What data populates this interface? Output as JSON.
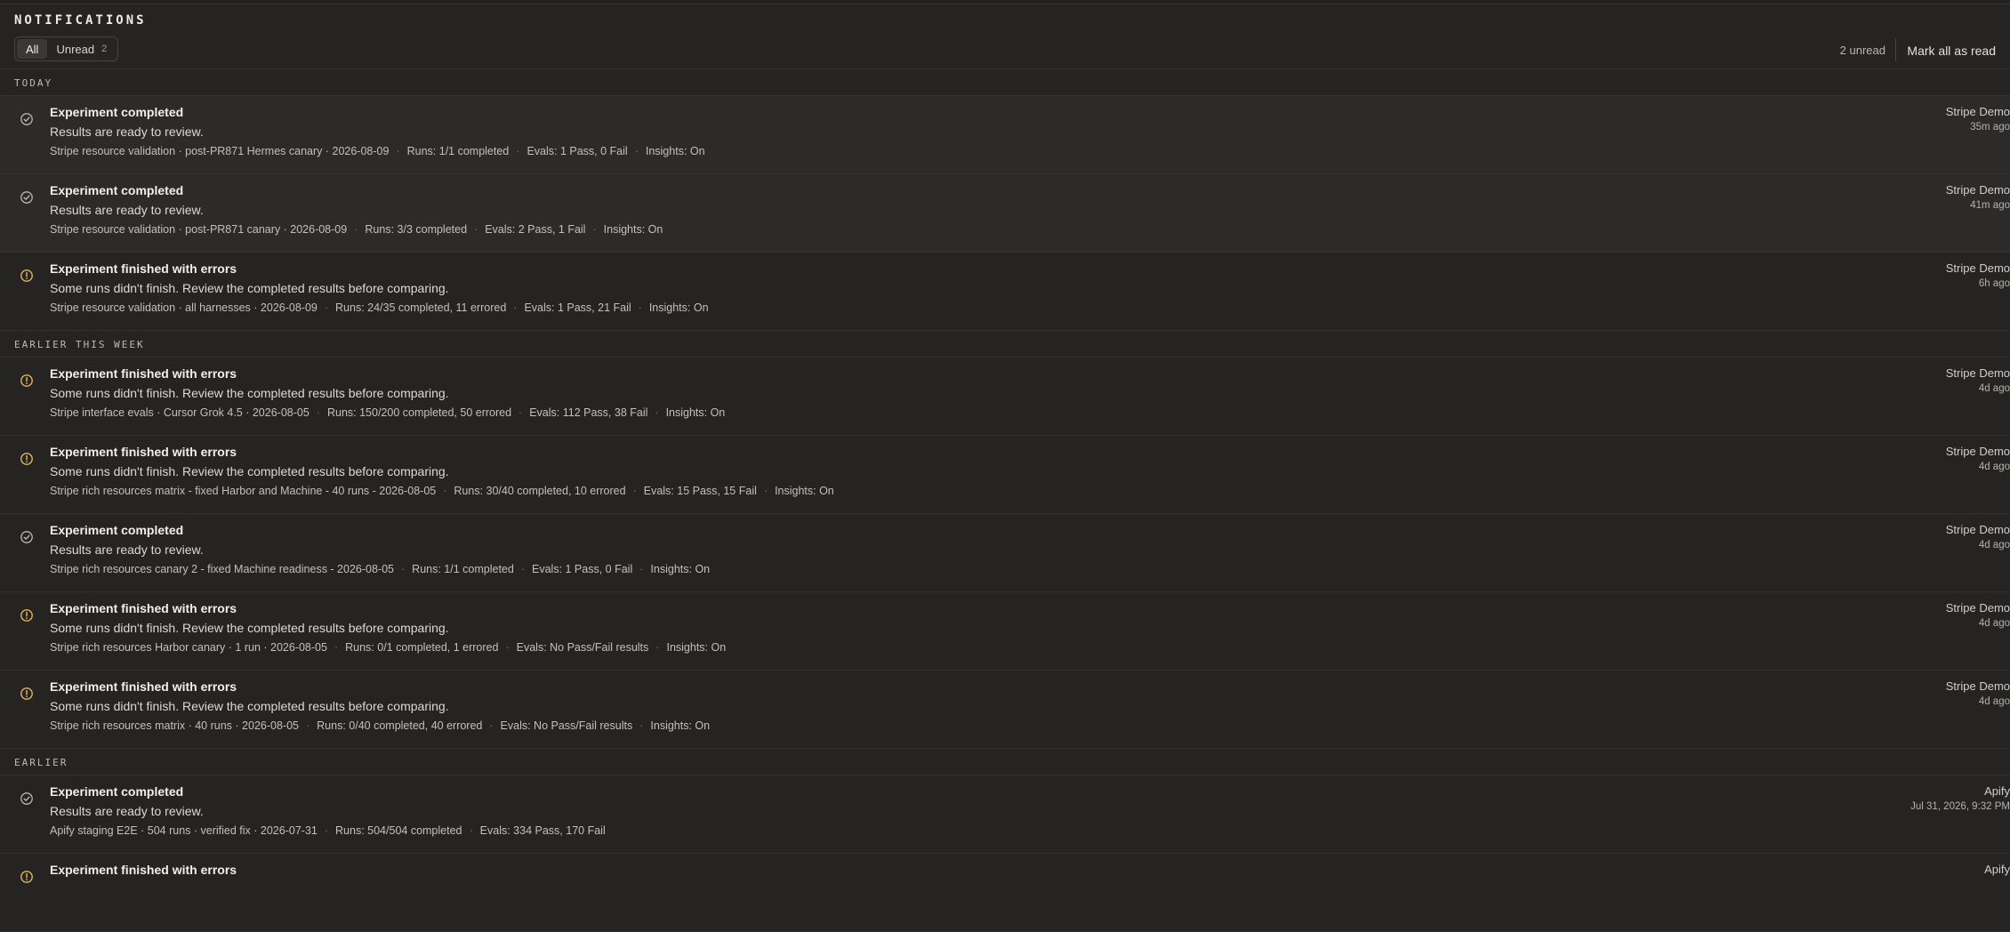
{
  "header": {
    "title": "NOTIFICATIONS",
    "filters": [
      {
        "label": "All",
        "active": true,
        "count": ""
      },
      {
        "label": "Unread",
        "active": false,
        "count": "2"
      }
    ],
    "unread_status": "2 unread",
    "mark_all_label": "Mark all as read"
  },
  "colors": {
    "success_icon": "#b9b7b0",
    "warning_icon": "#e0b45c",
    "unread_bg": "#2c2b29"
  },
  "sections": [
    {
      "label": "TODAY",
      "items": [
        {
          "icon": "check-circle-icon",
          "status": "success",
          "unread": true,
          "title": "Experiment completed",
          "body": "Results are ready to review.",
          "meta": [
            "Stripe resource validation · post-PR871 Hermes canary · 2026-08-09",
            "Runs: 1/1 completed",
            "Evals: 1 Pass, 0 Fail",
            "Insights: On"
          ],
          "source": "Stripe Demo",
          "time": "35m ago"
        },
        {
          "icon": "check-circle-icon",
          "status": "success",
          "unread": true,
          "title": "Experiment completed",
          "body": "Results are ready to review.",
          "meta": [
            "Stripe resource validation · post-PR871 canary · 2026-08-09",
            "Runs: 3/3 completed",
            "Evals: 2 Pass, 1 Fail",
            "Insights: On"
          ],
          "source": "Stripe Demo",
          "time": "41m ago"
        },
        {
          "icon": "warning-circle-icon",
          "status": "warning",
          "unread": false,
          "title": "Experiment finished with errors",
          "body": "Some runs didn't finish. Review the completed results before comparing.",
          "meta": [
            "Stripe resource validation · all harnesses · 2026-08-09",
            "Runs: 24/35 completed, 11 errored",
            "Evals: 1 Pass, 21 Fail",
            "Insights: On"
          ],
          "source": "Stripe Demo",
          "time": "6h ago"
        }
      ]
    },
    {
      "label": "EARLIER THIS WEEK",
      "items": [
        {
          "icon": "warning-circle-icon",
          "status": "warning",
          "unread": false,
          "title": "Experiment finished with errors",
          "body": "Some runs didn't finish. Review the completed results before comparing.",
          "meta": [
            "Stripe interface evals · Cursor Grok 4.5 · 2026-08-05",
            "Runs: 150/200 completed, 50 errored",
            "Evals: 112 Pass, 38 Fail",
            "Insights: On"
          ],
          "source": "Stripe Demo",
          "time": "4d ago"
        },
        {
          "icon": "warning-circle-icon",
          "status": "warning",
          "unread": false,
          "title": "Experiment finished with errors",
          "body": "Some runs didn't finish. Review the completed results before comparing.",
          "meta": [
            "Stripe rich resources matrix - fixed Harbor and Machine - 40 runs - 2026-08-05",
            "Runs: 30/40 completed, 10 errored",
            "Evals: 15 Pass, 15 Fail",
            "Insights: On"
          ],
          "source": "Stripe Demo",
          "time": "4d ago"
        },
        {
          "icon": "check-circle-icon",
          "status": "success",
          "unread": false,
          "title": "Experiment completed",
          "body": "Results are ready to review.",
          "meta": [
            "Stripe rich resources canary 2 - fixed Machine readiness - 2026-08-05",
            "Runs: 1/1 completed",
            "Evals: 1 Pass, 0 Fail",
            "Insights: On"
          ],
          "source": "Stripe Demo",
          "time": "4d ago"
        },
        {
          "icon": "warning-circle-icon",
          "status": "warning",
          "unread": false,
          "title": "Experiment finished with errors",
          "body": "Some runs didn't finish. Review the completed results before comparing.",
          "meta": [
            "Stripe rich resources Harbor canary · 1 run · 2026-08-05",
            "Runs: 0/1 completed, 1 errored",
            "Evals: No Pass/Fail results",
            "Insights: On"
          ],
          "source": "Stripe Demo",
          "time": "4d ago"
        },
        {
          "icon": "warning-circle-icon",
          "status": "warning",
          "unread": false,
          "title": "Experiment finished with errors",
          "body": "Some runs didn't finish. Review the completed results before comparing.",
          "meta": [
            "Stripe rich resources matrix · 40 runs · 2026-08-05",
            "Runs: 0/40 completed, 40 errored",
            "Evals: No Pass/Fail results",
            "Insights: On"
          ],
          "source": "Stripe Demo",
          "time": "4d ago"
        }
      ]
    },
    {
      "label": "EARLIER",
      "items": [
        {
          "icon": "check-circle-icon",
          "status": "success",
          "unread": false,
          "title": "Experiment completed",
          "body": "Results are ready to review.",
          "meta": [
            "Apify staging E2E · 504 runs · verified fix · 2026-07-31",
            "Runs: 504/504 completed",
            "Evals: 334 Pass, 170 Fail"
          ],
          "source": "Apify",
          "time": "Jul 31, 2026, 9:32 PM"
        },
        {
          "icon": "warning-circle-icon",
          "status": "warning",
          "unread": false,
          "title": "Experiment finished with errors",
          "body": "",
          "meta": [],
          "source": "Apify",
          "time": ""
        }
      ]
    }
  ]
}
